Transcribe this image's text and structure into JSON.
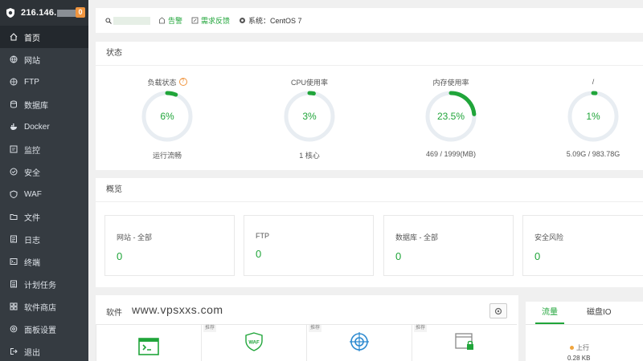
{
  "sidebar": {
    "ip": "216.146.",
    "badge": "0",
    "items": [
      {
        "label": "首页",
        "icon": "home-icon",
        "active": true
      },
      {
        "label": "网站",
        "icon": "globe-icon"
      },
      {
        "label": "FTP",
        "icon": "ftp-icon"
      },
      {
        "label": "数据库",
        "icon": "database-icon"
      },
      {
        "label": "Docker",
        "icon": "docker-icon"
      },
      {
        "label": "监控",
        "icon": "monitor-icon"
      },
      {
        "label": "安全",
        "icon": "shield-icon"
      },
      {
        "label": "WAF",
        "icon": "waf-icon"
      },
      {
        "label": "文件",
        "icon": "folder-icon"
      },
      {
        "label": "日志",
        "icon": "log-icon"
      },
      {
        "label": "终端",
        "icon": "terminal-icon"
      },
      {
        "label": "计划任务",
        "icon": "task-icon"
      },
      {
        "label": "软件商店",
        "icon": "store-icon"
      },
      {
        "label": "面板设置",
        "icon": "settings-icon"
      },
      {
        "label": "退出",
        "icon": "logout-icon"
      }
    ]
  },
  "topbar": {
    "alert_label": "告警",
    "feedback_label": "需求反馈",
    "system_label": "系统：CentOS 7"
  },
  "status": {
    "title": "状态",
    "gauges": [
      {
        "label": "负载状态",
        "value": "6%",
        "fraction": 0.06,
        "sub": "运行流畅",
        "help": "?"
      },
      {
        "label": "CPU使用率",
        "value": "3%",
        "fraction": 0.03,
        "sub": "1 核心"
      },
      {
        "label": "内存使用率",
        "value": "23.5%",
        "fraction": 0.235,
        "sub": "469 / 1999(MB)"
      },
      {
        "label": "/",
        "value": "1%",
        "fraction": 0.01,
        "sub": "5.09G / 983.78G"
      }
    ]
  },
  "overview": {
    "title": "概览",
    "cards": [
      {
        "label": "网站 - 全部",
        "value": "0"
      },
      {
        "label": "FTP",
        "value": "0"
      },
      {
        "label": "数据库 - 全部",
        "value": "0"
      },
      {
        "label": "安全风险",
        "value": "0"
      }
    ]
  },
  "software": {
    "title": "软件",
    "watermark": "www.vpsxxs.com",
    "tiles": [
      {
        "tag": "",
        "icon": "terminal-app-icon"
      },
      {
        "tag": "推荐",
        "icon": "waf-app-icon"
      },
      {
        "tag": "推荐",
        "icon": "target-app-icon"
      },
      {
        "tag": "推荐",
        "icon": "secure-window-app-icon"
      }
    ]
  },
  "traffic": {
    "tabs": [
      "流量",
      "磁盘IO"
    ],
    "up_label": "上行",
    "up_value": "0.28 KB"
  },
  "colors": {
    "accent": "#20a53a",
    "sidebar": "#353b41",
    "badge": "#f0953f"
  }
}
